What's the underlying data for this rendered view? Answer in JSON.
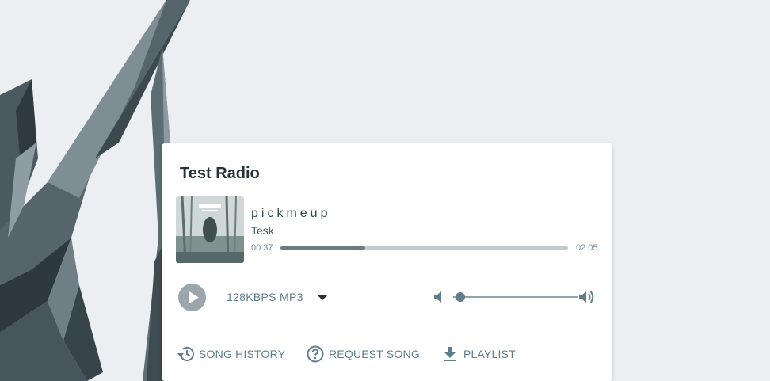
{
  "station": {
    "name": "Test Radio"
  },
  "now_playing": {
    "title": "pickmeup",
    "artist": "Tesk",
    "elapsed": "00:37",
    "duration": "02:05",
    "progress_fraction": 0.295,
    "cover_icon": "album-art"
  },
  "controls": {
    "play_icon": "play-icon",
    "stream_quality": "128KBPS MP3",
    "volume_fraction": 0.06,
    "volume_low_icon": "volume-low-icon",
    "volume_high_icon": "volume-high-icon"
  },
  "footer": {
    "history_label": "SONG HISTORY",
    "request_label": "REQUEST SONG",
    "playlist_label": "PLAYLIST"
  },
  "colors": {
    "background": "#eceef1",
    "card": "#ffffff",
    "accent": "#607d8b",
    "progress_fill": "#6b7b82",
    "progress_track": "#c4cbcf"
  }
}
